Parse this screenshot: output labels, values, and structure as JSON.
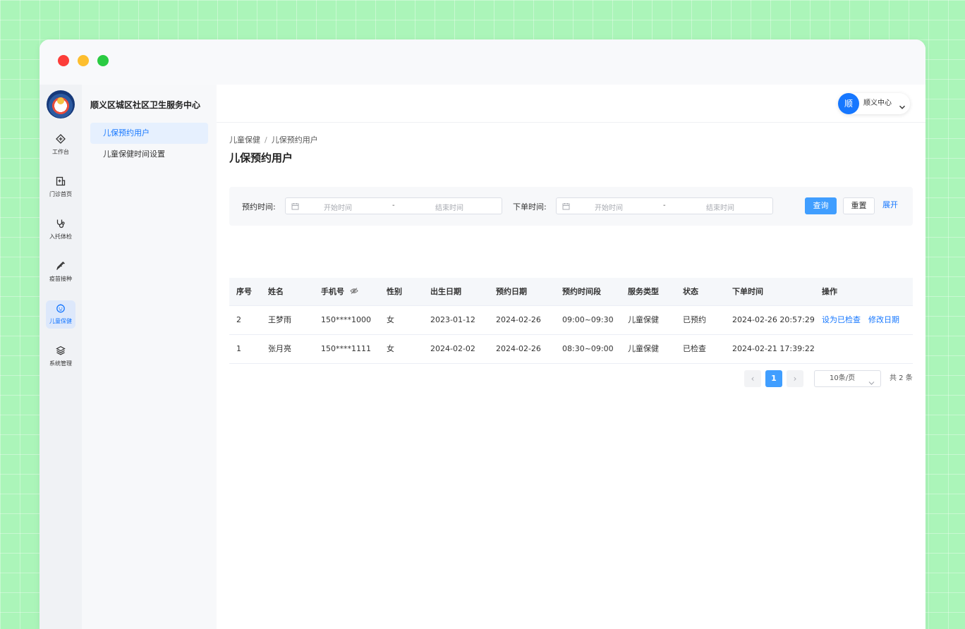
{
  "colors": {
    "accent": "#1677ff",
    "primary_button": "#409eff",
    "background": "#abf5b9"
  },
  "app": {
    "org_name": "顺义区城区社区卫生服务中心"
  },
  "rail": {
    "items": [
      {
        "label": "工作台",
        "icon": "dashboard-icon"
      },
      {
        "label": "门诊首页",
        "icon": "clinic-icon"
      },
      {
        "label": "入托体检",
        "icon": "stethoscope-icon"
      },
      {
        "label": "疫苗接种",
        "icon": "syringe-icon"
      },
      {
        "label": "儿童保健",
        "icon": "baby-icon",
        "active": true
      },
      {
        "label": "系统管理",
        "icon": "layers-icon"
      }
    ]
  },
  "sidebar": {
    "items": [
      {
        "label": "儿保预约用户",
        "active": true
      },
      {
        "label": "儿童保健时间设置"
      }
    ]
  },
  "header": {
    "avatar_text": "顺",
    "user_name": "顺义中心"
  },
  "breadcrumb": {
    "parent": "儿童保健",
    "separator": "/",
    "current": "儿保预约用户"
  },
  "page_title": "儿保预约用户",
  "filter": {
    "appt_label": "预约时间:",
    "order_label": "下单时间:",
    "start_placeholder": "开始时间",
    "end_placeholder": "结束时间",
    "dash": "-",
    "query_label": "查询",
    "reset_label": "重置",
    "expand_label": "展开"
  },
  "table": {
    "columns": [
      "序号",
      "姓名",
      "手机号",
      "性别",
      "出生日期",
      "预约日期",
      "预约时间段",
      "服务类型",
      "状态",
      "下单时间",
      "操作"
    ],
    "rows": [
      {
        "idx": "2",
        "name": "王梦雨",
        "phone": "150****1000",
        "gender": "女",
        "birth": "2023-01-12",
        "appt_date": "2024-02-26",
        "slot": "09:00~09:30",
        "service": "儿童保健",
        "status": "已预约",
        "order_time": "2024-02-26 20:57:29",
        "action_1": "设为已检查",
        "action_2": "修改日期"
      },
      {
        "idx": "1",
        "name": "张月亮",
        "phone": "150****1111",
        "gender": "女",
        "birth": "2024-02-02",
        "appt_date": "2024-02-26",
        "slot": "08:30~09:00",
        "service": "儿童保健",
        "status": "已检查",
        "order_time": "2024-02-21 17:39:22"
      }
    ]
  },
  "pagination": {
    "prev": "‹",
    "current": "1",
    "next": "›",
    "page_size": "10条/页",
    "total": "共 2 条"
  }
}
